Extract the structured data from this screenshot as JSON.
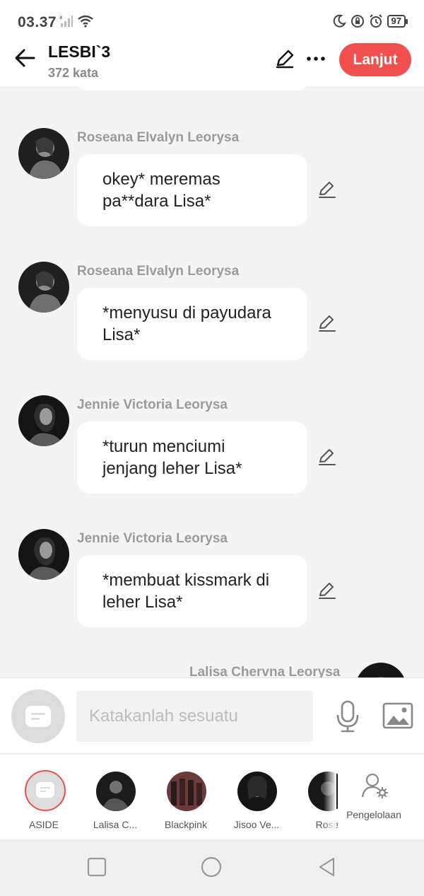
{
  "status_bar": {
    "time": "03.37",
    "battery": "97"
  },
  "header": {
    "title": "LESBI`3",
    "subtitle": "372 kata",
    "next_label": "Lanjut"
  },
  "messages": [
    {
      "sender": "Roseana Elvalyn Leorysa",
      "text": "okey* meremas pa**dara Lisa*"
    },
    {
      "sender": "Roseana Elvalyn Leorysa",
      "text": "*menyusu di payudara Lisa*"
    },
    {
      "sender": "Jennie Victoria Leorysa",
      "text": "*turun menciumi jenjang leher Lisa*"
    },
    {
      "sender": "Jennie Victoria Leorysa",
      "text": "*membuat kissmark di leher Lisa*"
    },
    {
      "sender": "Lalisa Chervna Leorysa",
      "text": ""
    }
  ],
  "composer": {
    "placeholder": "Katakanlah sesuatu"
  },
  "tray": {
    "items": [
      {
        "label": "ASIDE"
      },
      {
        "label": "Lalisa C..."
      },
      {
        "label": "Blackpink"
      },
      {
        "label": "Jisoo Ve..."
      },
      {
        "label": "Rose"
      }
    ],
    "manage_label": "Pengelolaan"
  },
  "colors": {
    "accent": "#f24f4f",
    "background": "#f4f4f4",
    "bubble": "#ffffff"
  }
}
